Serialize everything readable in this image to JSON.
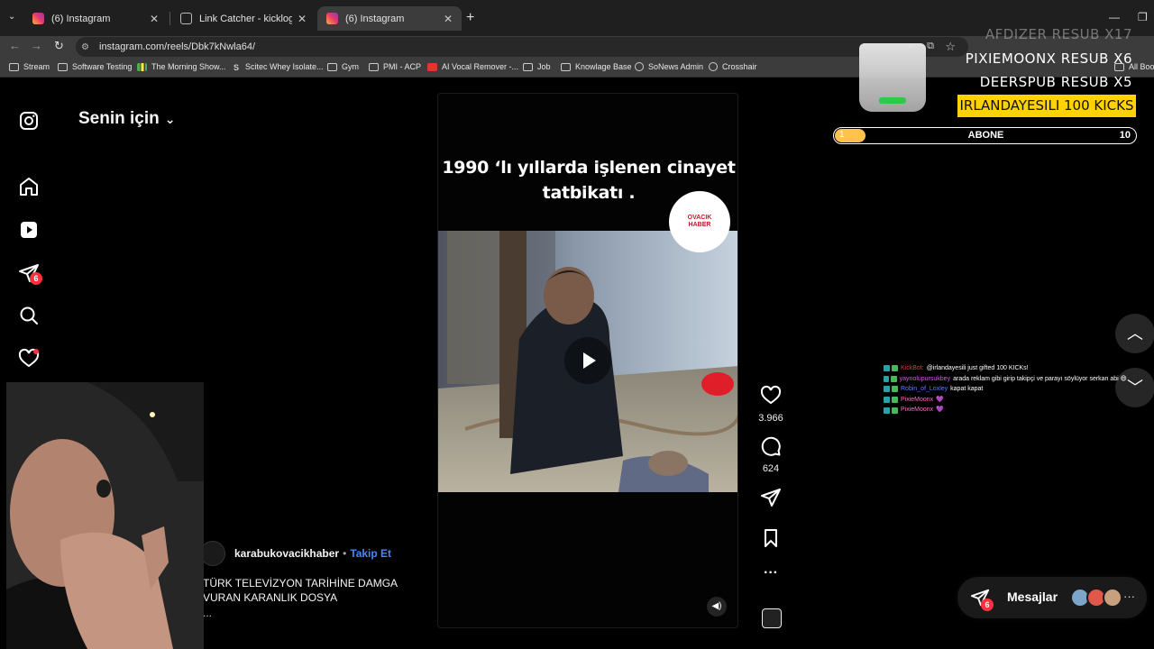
{
  "browser": {
    "tabs": [
      {
        "title": "(6) Instagram",
        "active": false
      },
      {
        "title": "Link Catcher - kicklogz Tools",
        "active": false
      },
      {
        "title": "(6) Instagram",
        "active": true
      }
    ],
    "url": "instagram.com/reels/Dbk7kNwla64/",
    "bookmarks": [
      "Stream",
      "Software Testing",
      "The Morning Show...",
      "Scitec Whey Isolate...",
      "Gym",
      "PMI - ACP",
      "AI Vocal Remover -...",
      "Job",
      "Knowlage Base",
      "SoNews Admin",
      "Crosshair",
      "All Book"
    ]
  },
  "instagram": {
    "feed_title": "Senin için",
    "notification_count": "6",
    "reel": {
      "caption_line1": "1990 ‘lı yıllarda işlenen cinayet",
      "caption_line2": "tatbikatı .",
      "logo_text1": "OVACIK",
      "logo_text2": "HABER"
    },
    "likes": "3.966",
    "comments": "624",
    "account": {
      "name": "karabukovacikhaber",
      "separator": "•",
      "follow": "Takip Et"
    },
    "post_caption": "TÜRK TELEVİZYON TARİHİNE DAMGA VURAN KARANLIK DOSYA",
    "post_more": "...",
    "messages": {
      "label": "Mesajlar",
      "badge": "6"
    }
  },
  "overlay": {
    "faded_line": "AFDIZER  RESUB X17",
    "line1": "PIXIEMOONX  RESUB X6",
    "line2": "DEERSPUB  RESUB X5",
    "highlight": "IRLANDAYESILI  100 KICKS",
    "goal": {
      "left": "1",
      "label": "ABONE",
      "right": "10",
      "progress": 0.1
    },
    "chat": [
      {
        "user": "KickBot:",
        "user_color": "#e53935",
        "message": "@irlandayesili just gifted 100 KICKs!"
      },
      {
        "user": "yaynolupursukbey",
        "user_color": "#d35ee0",
        "message": "arada reklam gibi girip takipçi ve parayı söylüyor serkan abi 😄"
      },
      {
        "user": "Robin_of_Loxley",
        "user_color": "#5b7cff",
        "message": "kapat kapat"
      },
      {
        "user": "PixieMoonx",
        "user_color": "#ff6ec7",
        "message": "💜"
      },
      {
        "user": "PixieMoonx",
        "user_color": "#ff6ec7",
        "message": "💜"
      }
    ]
  }
}
